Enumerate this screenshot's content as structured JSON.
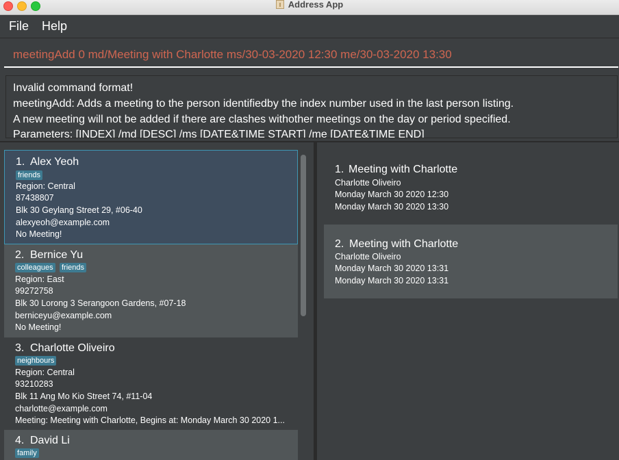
{
  "window": {
    "title": "Address App"
  },
  "menu": {
    "file": "File",
    "help": "Help"
  },
  "command": {
    "value": "meetingAdd 0 md/Meeting with Charlotte ms/30-03-2020 12:30 me/30-03-2020 13:30"
  },
  "result": {
    "lines": [
      "Invalid command format!",
      "meetingAdd: Adds a meeting to the person identifiedby the index number used in the last person listing.",
      "A new meeting will not be added if there are clashes withother meetings on the day or period specified.",
      "Parameters: [INDEX] /md [DESC] /ms [DATE&TIME START] /me [DATE&TIME END]"
    ]
  },
  "persons": [
    {
      "index": "1.",
      "name": "Alex Yeoh",
      "tags": [
        "friends"
      ],
      "region": "Region: Central",
      "phone": "87438807",
      "address": "Blk 30 Geylang Street 29, #06-40",
      "email": "alexyeoh@example.com",
      "meeting": "No Meeting!"
    },
    {
      "index": "2.",
      "name": "Bernice Yu",
      "tags": [
        "colleagues",
        "friends"
      ],
      "region": "Region: East",
      "phone": "99272758",
      "address": "Blk 30 Lorong 3 Serangoon Gardens, #07-18",
      "email": "berniceyu@example.com",
      "meeting": "No Meeting!"
    },
    {
      "index": "3.",
      "name": "Charlotte Oliveiro",
      "tags": [
        "neighbours"
      ],
      "region": "Region: Central",
      "phone": "93210283",
      "address": "Blk 11 Ang Mo Kio Street 74, #11-04",
      "email": "charlotte@example.com",
      "meeting": "Meeting: Meeting with Charlotte, Begins at: Monday March 30 2020 1..."
    },
    {
      "index": "4.",
      "name": "David Li",
      "tags": [
        "family"
      ]
    }
  ],
  "meetings": [
    {
      "index": "1.",
      "title": "Meeting with Charlotte",
      "person": "Charlotte Oliveiro",
      "start": "Monday March 30 2020 12:30",
      "end": "Monday March 30 2020 13:30"
    },
    {
      "index": "2.",
      "title": "Meeting with Charlotte",
      "person": "Charlotte Oliveiro",
      "start": "Monday March 30 2020 13:31",
      "end": "Monday March 30 2020 13:31"
    }
  ],
  "colors": {
    "command_text": "#d06651",
    "tag_bg": "#3e7b91",
    "selected_border": "#3e97b4",
    "background": "#3c3f41"
  }
}
